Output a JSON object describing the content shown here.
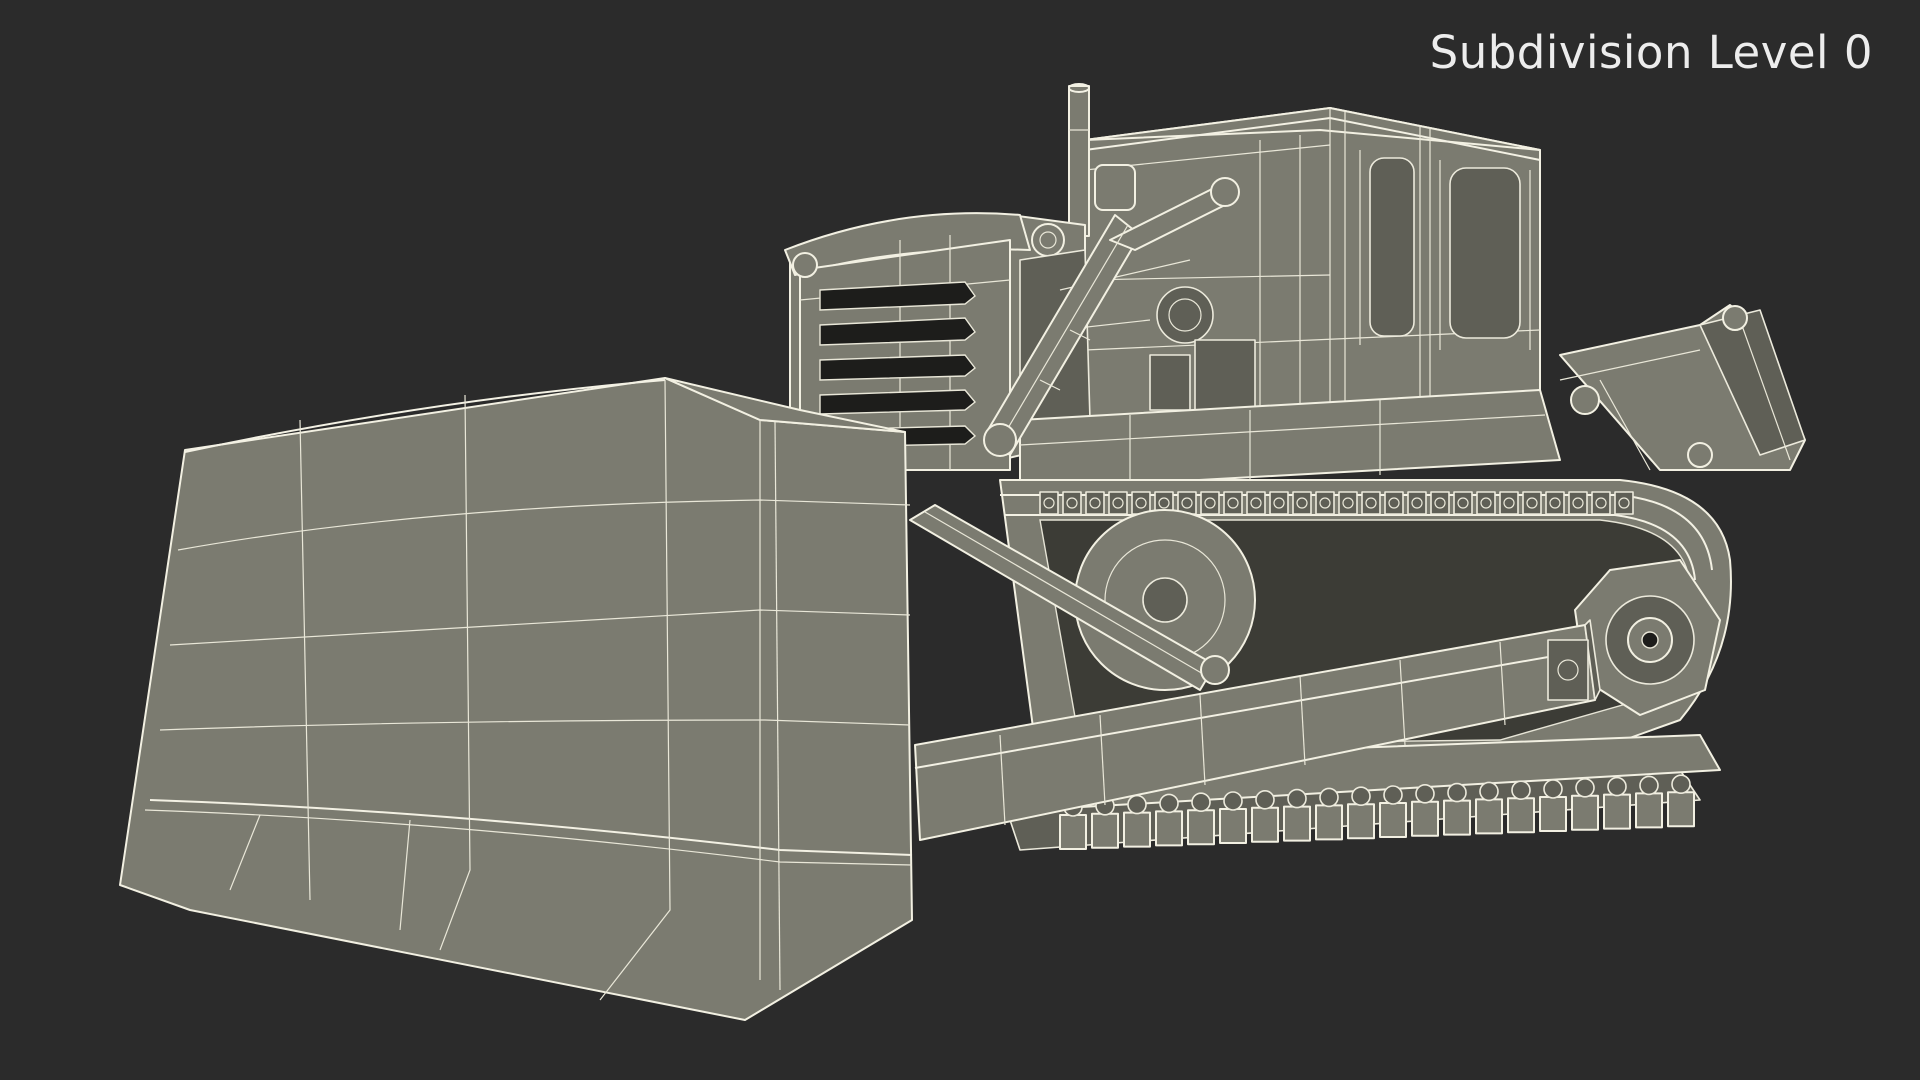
{
  "viewport": {
    "label": "Subdivision Level 0",
    "background_color": "#2b2b2b",
    "model_fill_color": "#7b7b70",
    "wireframe_color": "#f2f0e2"
  },
  "model": {
    "subject": "bulldozer wireframe render"
  }
}
